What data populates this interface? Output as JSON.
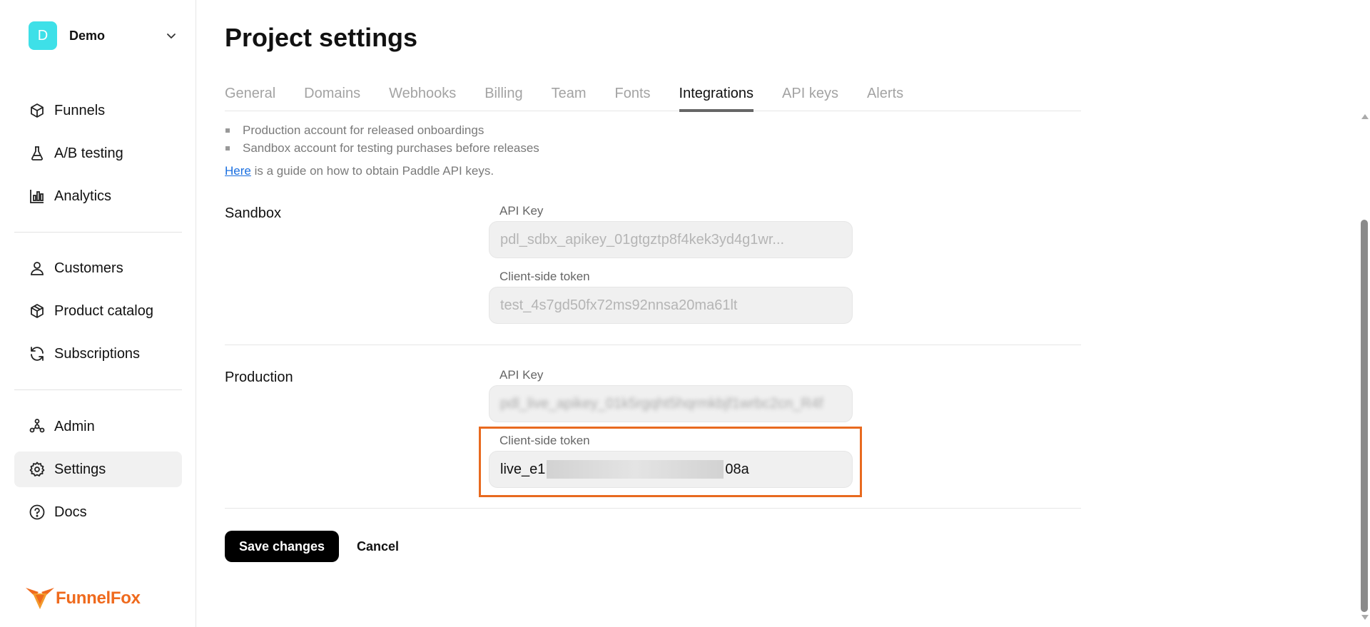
{
  "sidebar": {
    "project": {
      "initial": "D",
      "name": "Demo",
      "avatar_color": "#3ee0e8"
    },
    "nav_primary": [
      {
        "label": "Funnels",
        "icon": "box-icon"
      },
      {
        "label": "A/B testing",
        "icon": "flask-icon"
      },
      {
        "label": "Analytics",
        "icon": "bar-chart-icon"
      }
    ],
    "nav_secondary": [
      {
        "label": "Customers",
        "icon": "user-icon"
      },
      {
        "label": "Product catalog",
        "icon": "package-icon"
      },
      {
        "label": "Subscriptions",
        "icon": "refresh-icon"
      }
    ],
    "nav_tertiary": [
      {
        "label": "Admin",
        "icon": "admin-icon"
      },
      {
        "label": "Settings",
        "icon": "gear-icon",
        "active": true
      },
      {
        "label": "Docs",
        "icon": "help-circle-icon"
      }
    ],
    "logo_text": "FunnelFox",
    "brand_color": "#ef6a1d"
  },
  "page": {
    "title": "Project settings",
    "tabs": [
      "General",
      "Domains",
      "Webhooks",
      "Billing",
      "Team",
      "Fonts",
      "Integrations",
      "API keys",
      "Alerts"
    ],
    "active_tab": "Integrations"
  },
  "integrations": {
    "bullets": [
      "Production account for released onboardings",
      "Sandbox account for testing purchases before releases"
    ],
    "guide_link": "Here",
    "guide_text": " is a guide on how to obtain Paddle API keys.",
    "sandbox": {
      "label": "Sandbox",
      "api_key_label": "API Key",
      "api_key_value": "pdl_sdbx_apikey_01gtgztp8f4kek3yd4g1wr...",
      "token_label": "Client-side token",
      "token_value": "test_4s7gd50fx72ms92nnsa20ma61lt"
    },
    "production": {
      "label": "Production",
      "api_key_label": "API Key",
      "api_key_value": "pdl_live_apikey_01k5rgqht5hqrmkbjf1wrbc2cn_R4f",
      "token_label": "Client-side token",
      "token_prefix": "live_e1",
      "token_suffix": "08a"
    }
  },
  "actions": {
    "save": "Save changes",
    "cancel": "Cancel"
  },
  "highlight_color": "#e86a1f"
}
